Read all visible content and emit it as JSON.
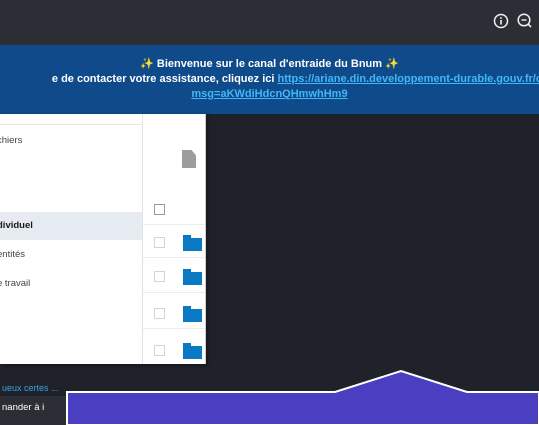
{
  "topbar": {
    "info_icon": "info-icon",
    "help_icon": "help-search-icon"
  },
  "banner": {
    "line1_prefix": "✨",
    "line1_text": " Bienvenue sur le canal d'entraide du Bnum ",
    "line1_suffix": "✨",
    "line2_text": "e de contacter votre assistance, cliquez ici ",
    "line2_link": "https://ariane.din.developpement-durable.gouv.fr/cl",
    "line3_link": "msg=aKWdiHdcnQHmwhHm9"
  },
  "nav": {
    "items": [
      {
        "label": "chiers"
      },
      {
        "label": "dividuel"
      },
      {
        "label": "entités"
      },
      {
        "label": "e travail"
      }
    ]
  },
  "bottom": {
    "strip_text": "ueux certes ... ",
    "left_text": "nander à i"
  },
  "colors": {
    "accent": "#0a78c2",
    "banner": "#0f4a8a",
    "overlay": "#4a3fc1"
  }
}
